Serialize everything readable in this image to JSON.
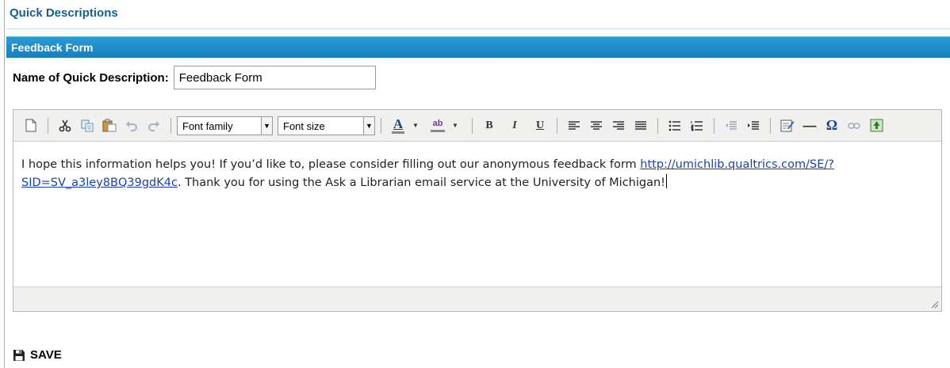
{
  "panel": {
    "title": "Quick Descriptions"
  },
  "form": {
    "header": "Feedback Form",
    "name_label": "Name of Quick Description:",
    "name_value": "Feedback Form"
  },
  "toolbar": {
    "font_family": "Font family",
    "font_size": "Font size",
    "bold": "B",
    "italic": "I",
    "underline": "U",
    "omega": "Ω",
    "hr": "—",
    "text_color": "A",
    "highlight": "ab"
  },
  "content": {
    "text_before_link": "I hope this information helps you! If you’d like to, please consider filling out our anonymous feedback form ",
    "link_text": "http://umichlib.qualtrics.com/SE/?SID=SV_a3ley8BQ39gdK4c",
    "text_after_link": ". Thank you for using the Ask a Librarian email service at the University of Michigan!"
  },
  "save": {
    "label": "SAVE"
  },
  "colors": {
    "panel_title": "#14608f",
    "header_bg": "#1a88c9",
    "link": "#1a3fb3"
  }
}
